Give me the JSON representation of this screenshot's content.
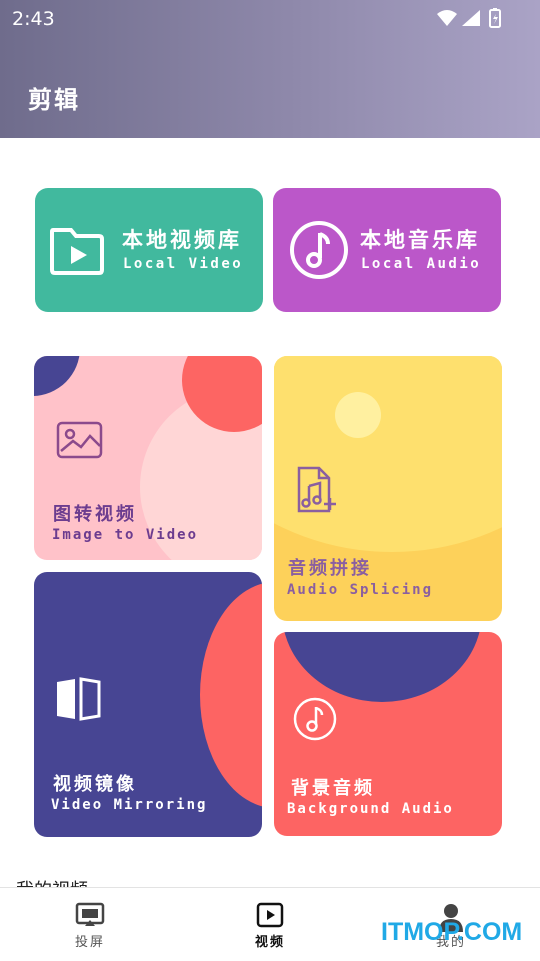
{
  "status_bar": {
    "time": "2:43"
  },
  "header": {
    "title": "剪辑"
  },
  "cards": {
    "local_video": {
      "title": "本地视频库",
      "subtitle": "Local Video",
      "color": "#41b99e",
      "icon": "folder-play-icon"
    },
    "local_audio": {
      "title": "本地音乐库",
      "subtitle": "Local Audio",
      "color": "#bb57c9",
      "icon": "music-note-circle-icon"
    }
  },
  "tiles": {
    "image_to_video": {
      "title": "图转视频",
      "subtitle": "Image to Video",
      "color": "#ffc2c9",
      "icon": "image-icon"
    },
    "audio_splicing": {
      "title": "音频拼接",
      "subtitle": "Audio Splicing",
      "color": "#fdd15a",
      "icon": "music-file-add-icon"
    },
    "video_mirroring": {
      "title": "视频镜像",
      "subtitle": "Video Mirroring",
      "color": "#474593",
      "icon": "mirror-icon"
    },
    "background_audio": {
      "title": "背景音频",
      "subtitle": "Background Audio",
      "color": "#fd6463",
      "icon": "music-note-circle-icon"
    }
  },
  "section": {
    "title": "我的视频"
  },
  "bottom_nav": {
    "items": [
      {
        "label": "投屏",
        "icon": "cast-screen-icon",
        "active": false
      },
      {
        "label": "视频",
        "icon": "video-play-icon",
        "active": true
      },
      {
        "label": "我的",
        "icon": "user-icon",
        "active": false
      }
    ]
  },
  "watermark": {
    "text": "ITMOP.COM"
  }
}
